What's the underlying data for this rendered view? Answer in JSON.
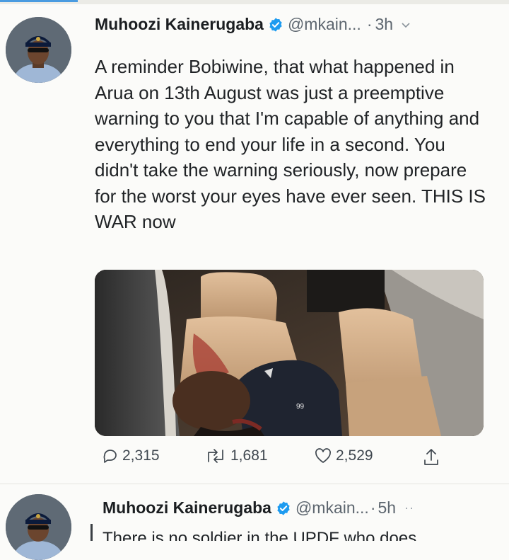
{
  "tweet1": {
    "name": "Muhoozi Kainerugaba",
    "handle": "@mkain...",
    "time": "3h",
    "dot": "·",
    "text": "A reminder Bobiwine, that what happened in Arua on 13th August was just a preemptive warning to you that I'm capable of anything and everything to end your life in a second. You didn't take the warning seriously, now prepare for the worst your eyes have ever seen. THIS IS WAR now",
    "media_shirt_text": "99",
    "replies": "2,315",
    "retweets": "1,681",
    "likes": "2,529"
  },
  "tweet2": {
    "name": "Muhoozi Kainerugaba",
    "handle": "@mkain...",
    "time": "5h",
    "dot": "·",
    "more": "··",
    "text_partial": "There is no soldier in the UPDF who does"
  },
  "colors": {
    "verified_blue": "#1d9bf0",
    "text_primary": "#202326",
    "text_secondary": "#5d666f",
    "accent_strip": "#4a9be0"
  },
  "icons": [
    "verified-badge-icon",
    "chevron-down-icon",
    "reply-icon",
    "retweet-icon",
    "like-icon",
    "share-icon",
    "more-icon"
  ]
}
